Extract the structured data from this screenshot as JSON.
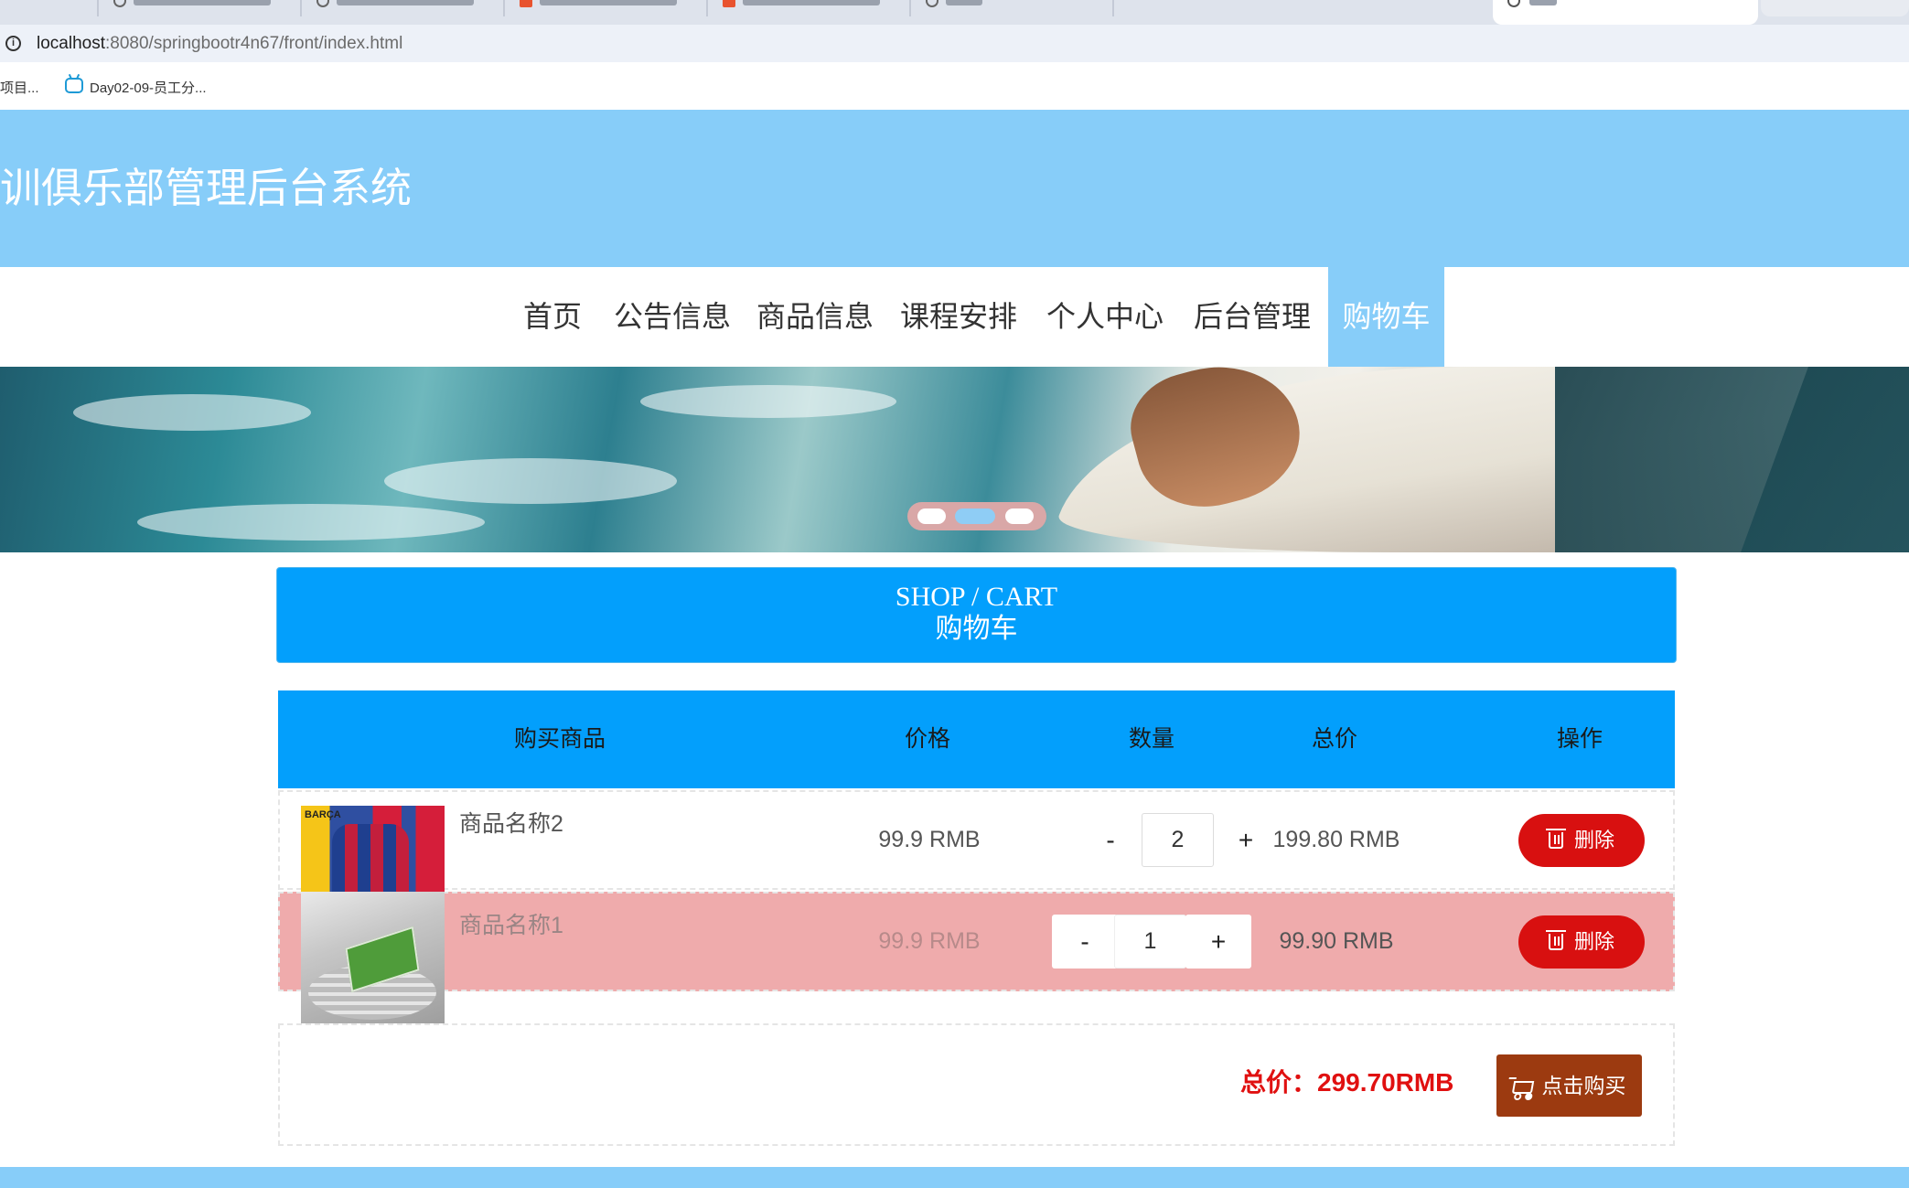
{
  "browser": {
    "url_host": "localhost",
    "url_rest": ":8080/springbootr4n67/front/index.html",
    "bookmarks": [
      "项目...",
      "Day02-09-员工分..."
    ]
  },
  "site": {
    "title": "训俱乐部管理后台系统"
  },
  "nav": {
    "items": [
      {
        "label": "首页"
      },
      {
        "label": "公告信息"
      },
      {
        "label": "商品信息"
      },
      {
        "label": "课程安排"
      },
      {
        "label": "个人中心"
      },
      {
        "label": "后台管理"
      },
      {
        "label": "购物车"
      }
    ],
    "active_index": 6
  },
  "banner": {
    "slide_count": 3,
    "active_slide": 1
  },
  "shop": {
    "title_en": "SHOP / CART",
    "title_zh": "购物车"
  },
  "table": {
    "headers": {
      "product": "购买商品",
      "price": "价格",
      "quantity": "数量",
      "total": "总价",
      "action": "操作"
    },
    "rows": [
      {
        "name": "商品名称2",
        "price": "99.9 RMB",
        "qty": "2",
        "minus": "-",
        "plus": "+",
        "total": "199.80 RMB",
        "delete_label": "删除",
        "highlighted": false
      },
      {
        "name": "商品名称1",
        "price": "99.9 RMB",
        "qty": "1",
        "minus": "-",
        "plus": "+",
        "total": "99.90 RMB",
        "delete_label": "删除",
        "highlighted": true
      }
    ]
  },
  "summary": {
    "total_label": "总价：299.70RMB",
    "buy_label": "点击购买"
  },
  "colors": {
    "header_bg": "#87cdf9",
    "shop_blue": "#039ffc",
    "delete_red": "#d81010",
    "buy_brown": "#9c3a10",
    "highlight_row": "#efabac",
    "total_red": "#e01010"
  }
}
